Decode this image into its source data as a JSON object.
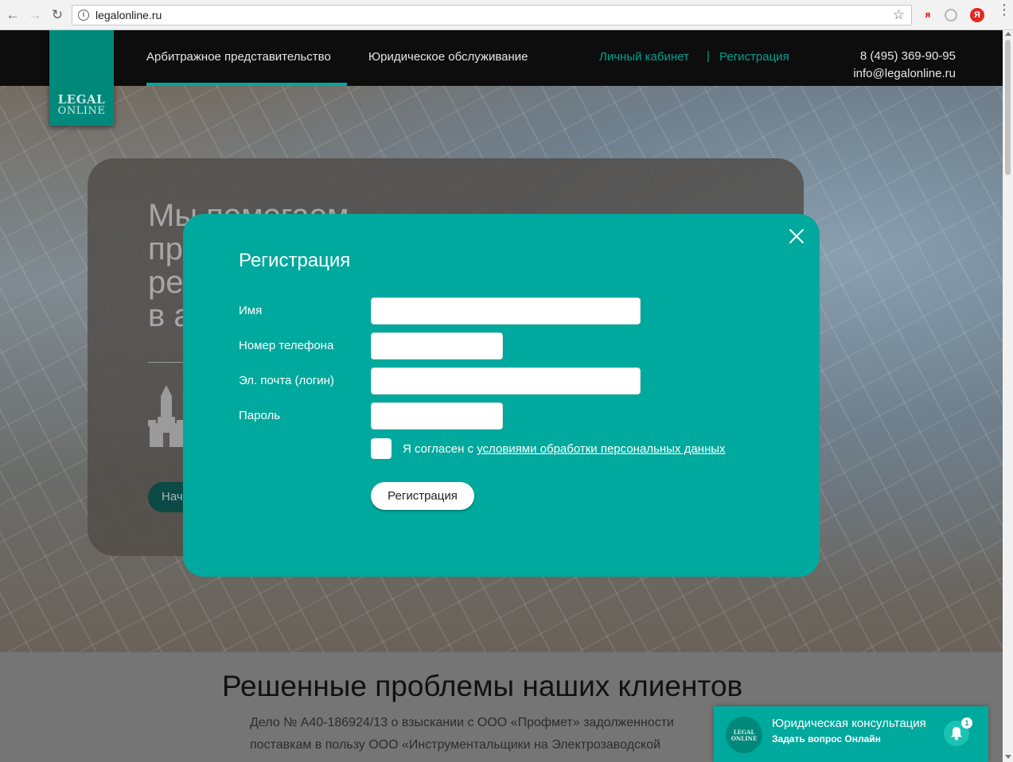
{
  "browser": {
    "url": "legalonline.ru",
    "back_icon": "arrow-left-icon",
    "forward_icon": "arrow-right-icon",
    "reload_icon": "reload-icon",
    "ext_yandex_label": "я",
    "ext_yandex2_label": "Я"
  },
  "header": {
    "logo_line1": "LEGAL",
    "logo_line2": "ONLINE",
    "nav": [
      "Арбитражное представительство",
      "Юридическое обслуживание"
    ],
    "account": "Личный кабинет",
    "separator": "|",
    "register": "Регистрация",
    "phone": "8 (495) 369-90-95",
    "email": "info@legalonline.ru"
  },
  "hero": {
    "title_lines": [
      "Мы помогаем",
      "пр",
      "ре",
      "в а"
    ],
    "button_label": "Нач"
  },
  "section": {
    "title": "Решенные проблемы наших клиентов",
    "text_line1": "Дело № А40-186924/13 о взыскании с ООО «Профмет» задолженности",
    "text_line2": "поставкам в пользу ООО «Инструментальщики на Электрозаводской"
  },
  "modal": {
    "title": "Регистрация",
    "fields": [
      {
        "label": "Имя",
        "value": ""
      },
      {
        "label": "Номер телефона",
        "value": ""
      },
      {
        "label": "Эл. почта (логин)",
        "value": ""
      },
      {
        "label": "Пароль",
        "value": ""
      }
    ],
    "agree_prefix": "Я согласен с ",
    "agree_link": "условиями обработки персональных данных",
    "submit_label": "Регистрация"
  },
  "chat": {
    "logo_line1": "LEGAL",
    "logo_line2": "ONLINE",
    "title": "Юридическая консультация",
    "subtitle": "Задать вопрос Онлайн",
    "badge": "1"
  },
  "colors": {
    "accent": "#00a99d",
    "logo": "#00897b",
    "topbar": "#0d0d0d"
  }
}
